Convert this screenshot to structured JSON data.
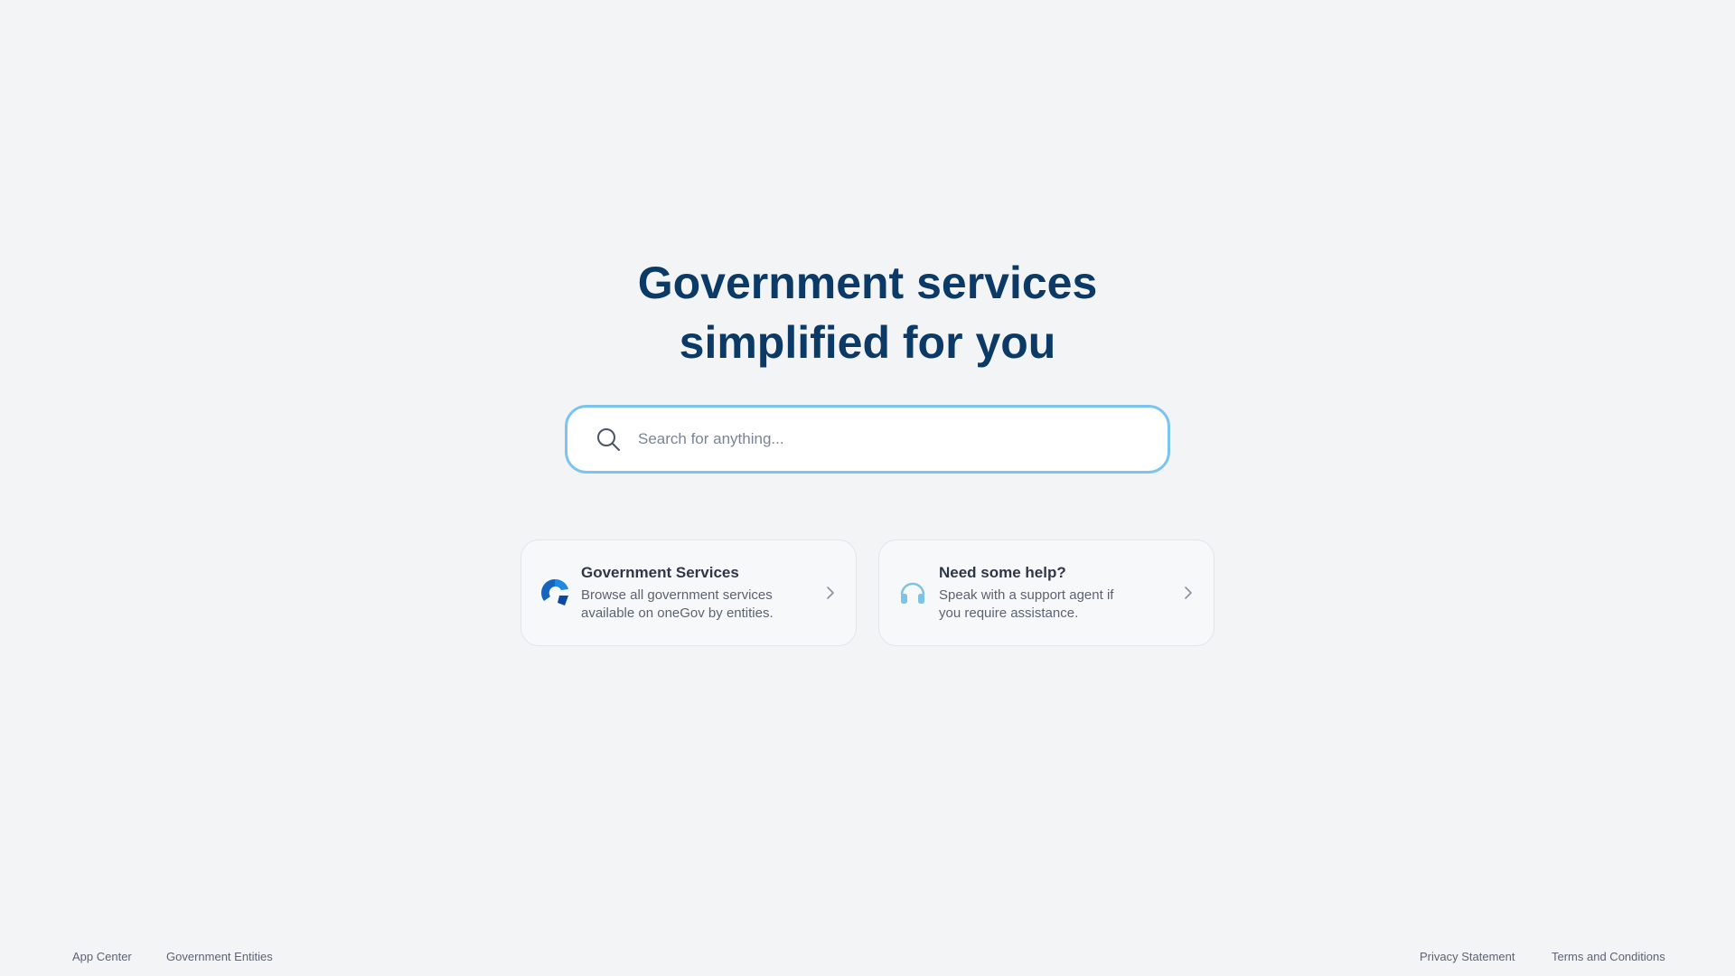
{
  "hero": {
    "title_line1": "Government services",
    "title_line2": "simplified for you"
  },
  "search": {
    "placeholder": "Search for anything...",
    "value": "",
    "icon": "search-icon"
  },
  "cards": [
    {
      "title": "Government Services",
      "description": "Browse all government services available on oneGov by entities.",
      "icon": "onegov-logo-icon"
    },
    {
      "title": "Need some help?",
      "description": "Speak with a support agent if you require assistance.",
      "icon": "headset-icon"
    }
  ],
  "footer": {
    "left_links": [
      "App Center",
      "Government Entities"
    ],
    "right_links": [
      "Privacy Statement",
      "Terms and Conditions"
    ]
  },
  "colors": {
    "background": "#f3f4f6",
    "title": "#0b3a66",
    "search_border": "#7cc4f0",
    "brand_blue": "#1565c0",
    "help_icon": "#7cc4e6"
  }
}
